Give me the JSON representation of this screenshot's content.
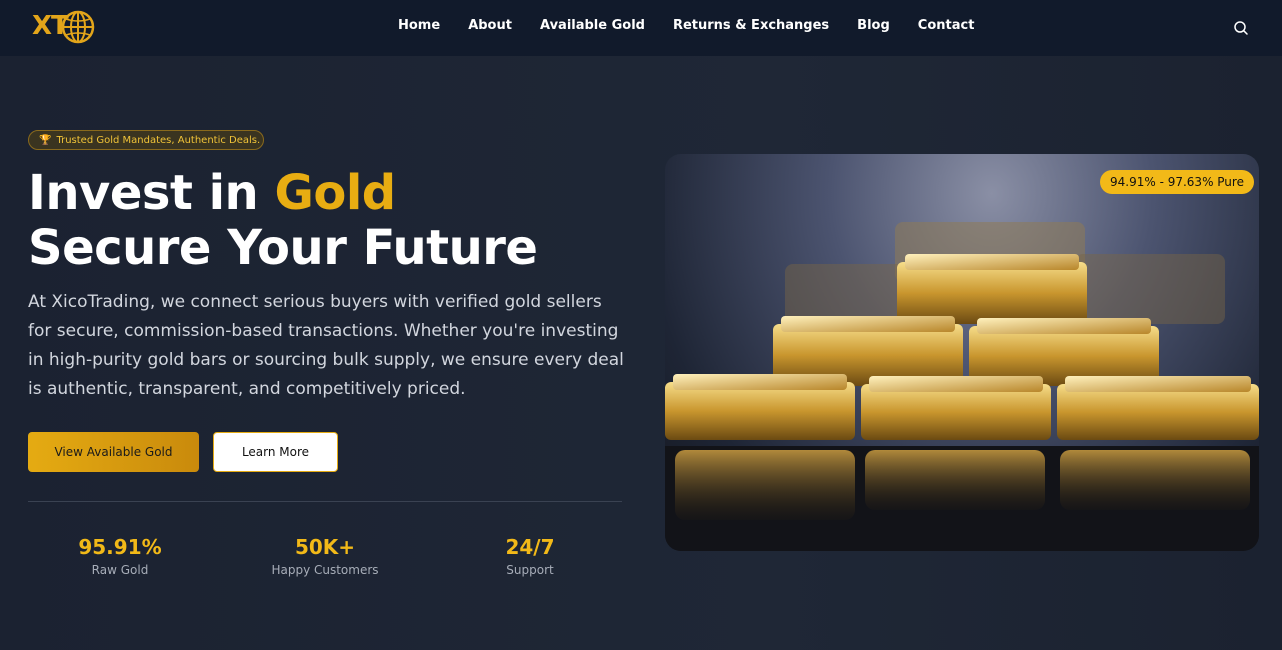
{
  "brand": {
    "logo_text": "XT"
  },
  "nav": {
    "items": [
      "Home",
      "About",
      "Available Gold",
      "Returns & Exchanges",
      "Blog",
      "Contact"
    ],
    "search_icon": "search-icon"
  },
  "hero": {
    "badge_icon": "🏆",
    "badge_text": "Trusted Gold Mandates, Authentic Deals.",
    "title_prefix": "Invest in ",
    "title_highlight": "Gold",
    "title_line2": "Secure Your Future",
    "description": "At XicoTrading, we connect serious buyers with verified gold sellers for secure, commission-based transactions. Whether you're investing in high-purity gold bars or sourcing bulk supply, we ensure every deal is authentic, transparent, and competitively priced.",
    "primary_button": "View Available Gold",
    "secondary_button": "Learn More",
    "purity_badge": "94.91% - 97.63% Pure"
  },
  "stats": [
    {
      "value": "95.91%",
      "label": "Raw Gold"
    },
    {
      "value": "50K+",
      "label": "Happy Customers"
    },
    {
      "value": "24/7",
      "label": "Support"
    }
  ],
  "colors": {
    "accent": "#e8ad12",
    "nav_bg": "#111a2b",
    "page_bg": "#1f2736"
  }
}
